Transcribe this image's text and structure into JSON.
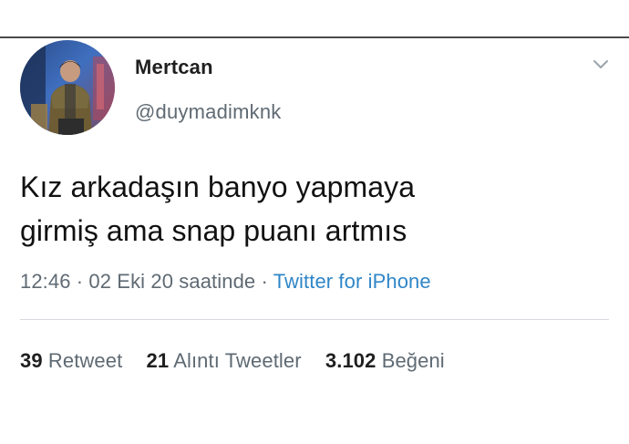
{
  "tweet": {
    "display_name": "Mertcan",
    "handle": "@duymadimknk",
    "text_line_1": "Kız arkadaşın banyo yapmaya",
    "text_line_2": "girmiş ama snap puanı artmıs",
    "time": "12:46",
    "separator": " · ",
    "date": "02 Eki 20 saatinde",
    "source": "Twitter for iPhone"
  },
  "stats": {
    "retweets_count": "39",
    "retweets_label": "Retweet",
    "quotes_count": "21",
    "quotes_label": "Alıntı Tweetler",
    "likes_count": "3.102",
    "likes_label": "Beğeni"
  },
  "icons": {
    "avatar": "profile-photo",
    "menu": "chevron-down-icon"
  },
  "colors": {
    "link_blue": "#2f86c7",
    "secondary_text": "#5f6a73",
    "primary_text": "#111111"
  }
}
